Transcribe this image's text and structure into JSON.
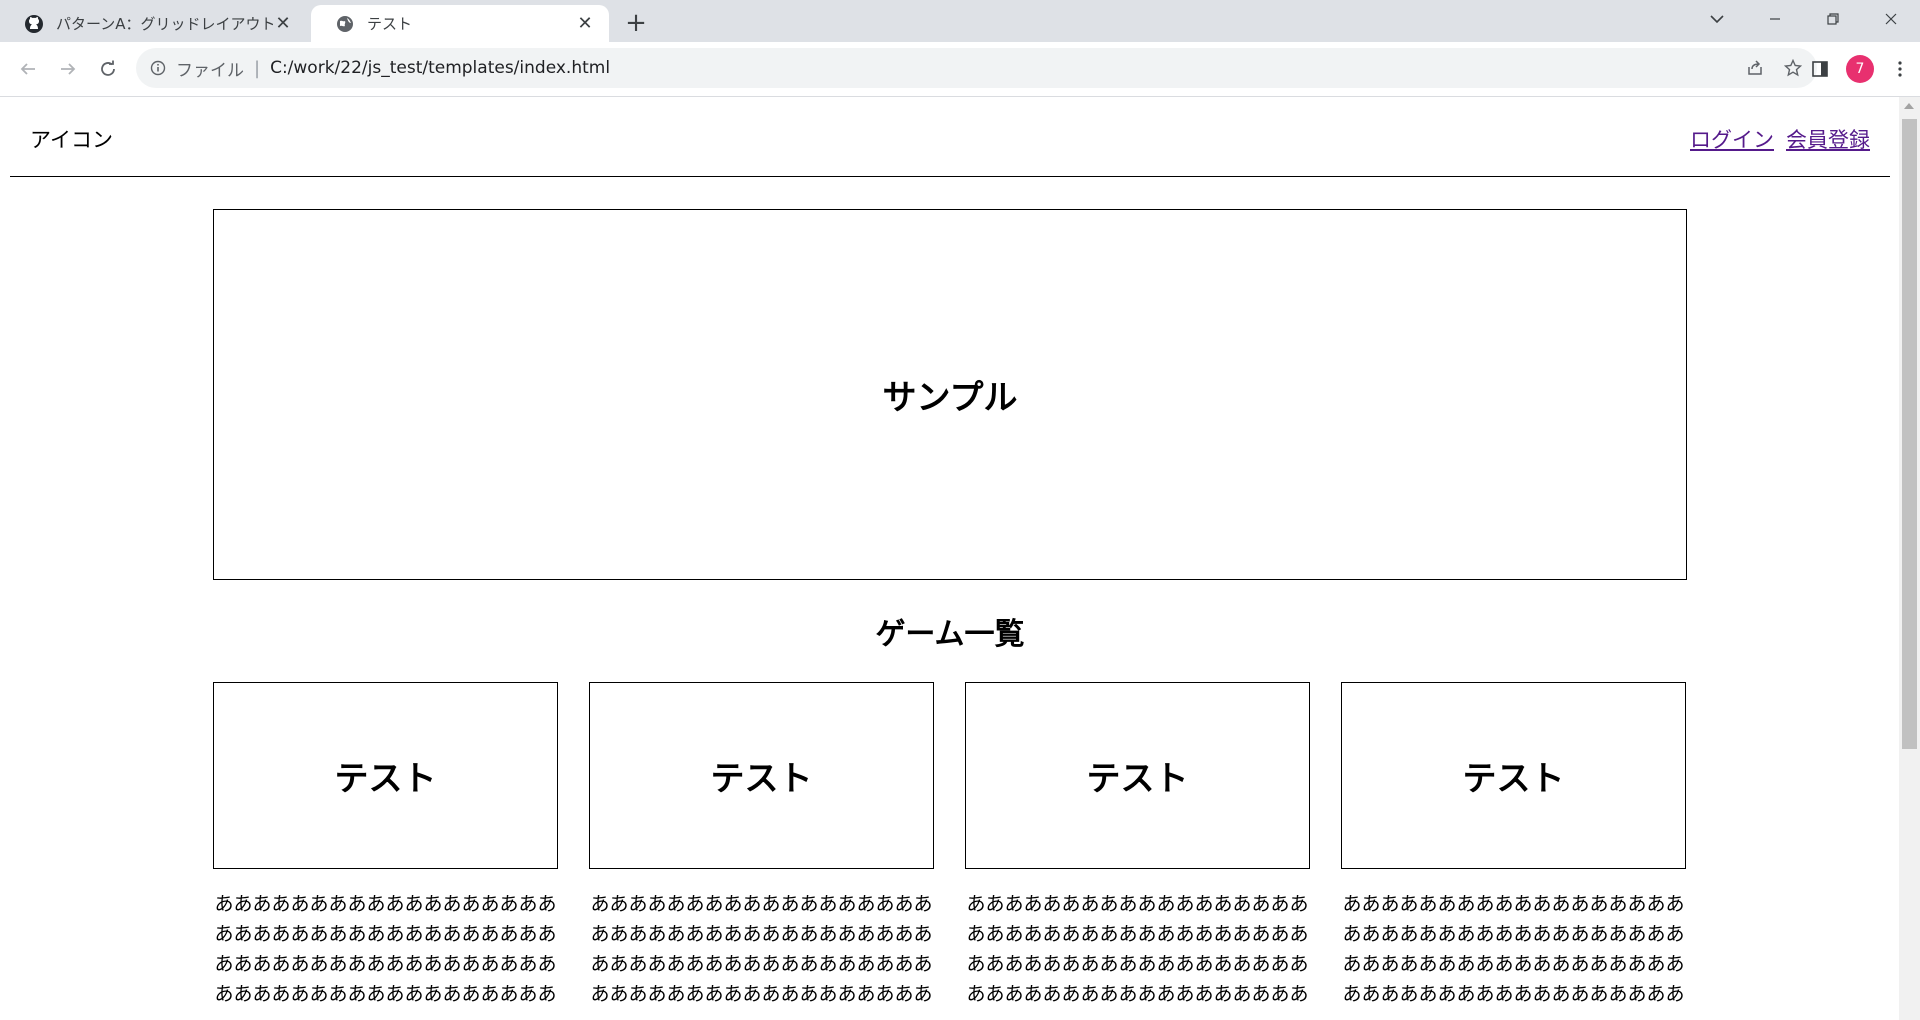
{
  "browser": {
    "tabs": [
      {
        "title": "パターンA：グリッドレイアウトバージョン",
        "icon": "github-icon",
        "active": false
      },
      {
        "title": "テスト",
        "icon": "globe-icon",
        "active": true
      }
    ],
    "address": {
      "scheme_label": "ファイル",
      "url": "C:/work/22/js_test/templates/index.html"
    },
    "profile_badge": "7",
    "colors": {
      "profile": "#e8306f",
      "tabbar": "#dee1e6",
      "link_visited": "#551a8b"
    }
  },
  "header": {
    "logo": "アイコン",
    "login_label": "ログイン",
    "register_label": "会員登録"
  },
  "hero": {
    "label": "サンプル"
  },
  "games_section": {
    "title": "ゲーム一覧",
    "items": [
      {
        "thumb_label": "テスト",
        "description": "ああああああああああああああああああああああああああああああああああああああああああああああああああああああああああああああああああああああああ"
      },
      {
        "thumb_label": "テスト",
        "description": "ああああああああああああああああああああああああああああああああああああああああああああああああああああああああああああああああああああああああ"
      },
      {
        "thumb_label": "テスト",
        "description": "ああああああああああああああああああああああああああああああああああああああああああああああああああああああああああああああああああああああああ"
      },
      {
        "thumb_label": "テスト",
        "description": "ああああああああああああああああああああああああああああああああああああああああああああああああああああああああああああああああああああああああ"
      }
    ]
  }
}
